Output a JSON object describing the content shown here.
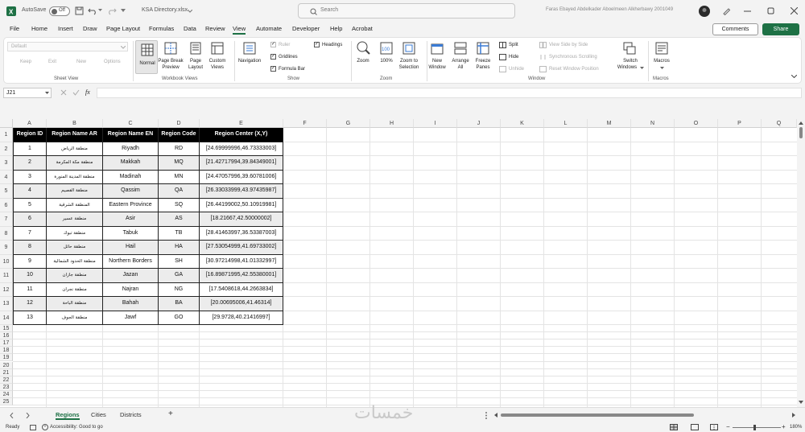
{
  "titlebar": {
    "autosave_label": "AutoSave",
    "autosave_state": "Off",
    "filename": "KSA Directory.xlsx",
    "search_placeholder": "Search",
    "user_name": "Faras Ebayed Abdelkader Aboelmeen Alkherbawy 2001049"
  },
  "menu": {
    "items": [
      "File",
      "Home",
      "Insert",
      "Draw",
      "Page Layout",
      "Formulas",
      "Data",
      "Review",
      "View",
      "Automate",
      "Developer",
      "Help",
      "Acrobat"
    ],
    "active": "View",
    "comments_label": "Comments",
    "share_label": "Share"
  },
  "ribbon": {
    "sheet_view": {
      "dropdown_value": "Default",
      "keep": "Keep",
      "exit": "Exit",
      "new": "New",
      "options": "Options",
      "group": "Sheet View"
    },
    "workbook_views": {
      "normal": "Normal",
      "page_break_1": "Page Break",
      "page_break_2": "Preview",
      "page_layout_1": "Page",
      "page_layout_2": "Layout",
      "custom_1": "Custom",
      "custom_2": "Views",
      "group": "Workbook Views"
    },
    "show": {
      "navigation": "Navigation",
      "ruler": "Ruler",
      "gridlines": "Gridlines",
      "formula_bar": "Formula Bar",
      "headings": "Headings",
      "group": "Show"
    },
    "zoom": {
      "zoom": "Zoom",
      "hundred": "100%",
      "zoom_sel_1": "Zoom to",
      "zoom_sel_2": "Selection",
      "group": "Zoom"
    },
    "window": {
      "new_1": "New",
      "new_2": "Window",
      "arrange_1": "Arrange",
      "arrange_2": "All",
      "freeze_1": "Freeze",
      "freeze_2": "Panes",
      "split": "Split",
      "hide": "Hide",
      "unhide": "Unhide",
      "side_by_side": "View Side by Side",
      "sync_scroll": "Synchronous Scrolling",
      "reset_pos": "Reset Window Position",
      "switch_1": "Switch",
      "switch_2": "Windows",
      "group": "Window"
    },
    "macros": {
      "label": "Macros",
      "group": "Macros"
    }
  },
  "formula_bar": {
    "name_box": "J21",
    "fx": "fx",
    "content": ""
  },
  "grid": {
    "columns": [
      "A",
      "B",
      "C",
      "D",
      "E",
      "F",
      "G",
      "H",
      "I",
      "J",
      "K",
      "L",
      "M",
      "N",
      "O",
      "P",
      "Q"
    ],
    "rows": [
      "1",
      "2",
      "3",
      "4",
      "5",
      "6",
      "7",
      "8",
      "9",
      "10",
      "11",
      "12",
      "13",
      "14",
      "15",
      "16",
      "17",
      "18",
      "19",
      "20",
      "21",
      "22",
      "23",
      "24",
      "25"
    ]
  },
  "table": {
    "headers": [
      "Region ID",
      "Region Name AR",
      "Region Name EN",
      "Region Code",
      "Region Center (X,Y)"
    ],
    "rows": [
      [
        "1",
        "منطقة الرياض",
        "Riyadh",
        "RD",
        "[24.69999996,46.73333003]"
      ],
      [
        "2",
        "منطقة مكة المكرمة",
        "Makkah",
        "MQ",
        "[21.42717994,39.84349001]"
      ],
      [
        "3",
        "منطقة المدينة المنورة",
        "Madinah",
        "MN",
        "[24.47057996,39.60781006]"
      ],
      [
        "4",
        "منطقة القصيم",
        "Qassim",
        "QA",
        "[26.33033999,43.97435987]"
      ],
      [
        "5",
        "المنطقة الشرقية",
        "Eastern Province",
        "SQ",
        "[26.44199002,50.10919981]"
      ],
      [
        "6",
        "منطقة عسير",
        "Asir",
        "AS",
        "[18.21667,42.50000002]"
      ],
      [
        "7",
        "منطقة تبوك",
        "Tabuk",
        "TB",
        "[28.41463997,36.53387003]"
      ],
      [
        "8",
        "منطقة حائل",
        "Hail",
        "HA",
        "[27.53054999,41.69733002]"
      ],
      [
        "9",
        "منطقة الحدود الشمالية",
        "Northern Borders",
        "SH",
        "[30.97214998,41.01332997]"
      ],
      [
        "10",
        "منطقة جازان",
        "Jazan",
        "GA",
        "[16.89871995,42.55380001]"
      ],
      [
        "11",
        "منطقة نجران",
        "Najran",
        "NG",
        "[17.5408618,44.2663834]"
      ],
      [
        "12",
        "منطقة الباحة",
        "Bahah",
        "BA",
        "[20.00695006,41.46314]"
      ],
      [
        "13",
        "منطقة الجوف",
        "Jawf",
        "GO",
        "[29.9728,40.21416997]"
      ]
    ]
  },
  "sheets": {
    "tabs": [
      "Regions",
      "Cities",
      "Districts"
    ],
    "active": "Regions",
    "add": "+"
  },
  "watermark": "خمسات",
  "status": {
    "ready": "Ready",
    "accessibility": "Accessibility: Good to go",
    "zoom": "180%"
  }
}
